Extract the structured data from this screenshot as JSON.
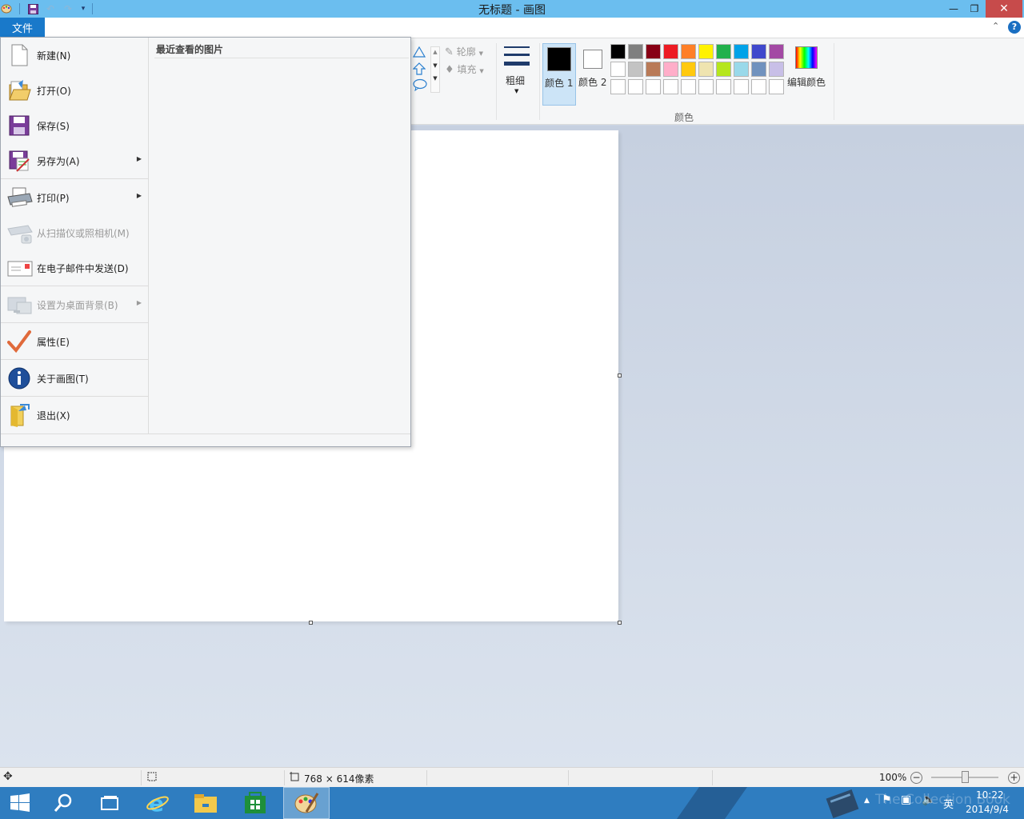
{
  "window": {
    "title": "无标题 - 画图",
    "minimize_icon": "minimize-icon",
    "maximize_icon": "restore-icon",
    "close_icon": "close-icon"
  },
  "quick_access": {
    "items": [
      "app-icon",
      "save-icon",
      "undo-icon",
      "redo-icon",
      "customize-icon"
    ]
  },
  "ribbon": {
    "file_tab": "文件",
    "shapes": {
      "outline_label": "轮廓",
      "fill_label": "填充"
    },
    "size_label": "粗细",
    "colors": {
      "color1_label": "颜色 1",
      "color2_label": "颜色 2",
      "edit_colors_label": "编辑颜色",
      "group_label": "颜色",
      "color1_value": "#000000",
      "color2_value": "#ffffff",
      "palette_row1": [
        "#000000",
        "#7f7f7f",
        "#880015",
        "#ed1c24",
        "#ff7f27",
        "#fff200",
        "#22b14c",
        "#00a2e8",
        "#3f48cc",
        "#a349a4"
      ],
      "palette_row2": [
        "#ffffff",
        "#c3c3c3",
        "#b97a57",
        "#ffaec9",
        "#ffc90e",
        "#efe4b0",
        "#b5e61d",
        "#99d9ea",
        "#7092be",
        "#c8bfe7"
      ],
      "palette_row3": [
        "#ffffff",
        "#ffffff",
        "#ffffff",
        "#ffffff",
        "#ffffff",
        "#ffffff",
        "#ffffff",
        "#ffffff",
        "#ffffff",
        "#ffffff"
      ]
    }
  },
  "file_menu": {
    "items": [
      {
        "label": "新建(N)",
        "icon": "new-file-icon",
        "has_submenu": false,
        "disabled": false
      },
      {
        "label": "打开(O)",
        "icon": "open-folder-icon",
        "has_submenu": false,
        "disabled": false
      },
      {
        "label": "保存(S)",
        "icon": "save-disk-icon",
        "has_submenu": false,
        "disabled": false
      },
      {
        "label": "另存为(A)",
        "icon": "save-as-icon",
        "has_submenu": true,
        "disabled": false
      },
      {
        "label": "打印(P)",
        "icon": "printer-icon",
        "has_submenu": true,
        "disabled": false
      },
      {
        "label": "从扫描仪或照相机(M)",
        "icon": "scanner-icon",
        "has_submenu": false,
        "disabled": true
      },
      {
        "label": "在电子邮件中发送(D)",
        "icon": "email-icon",
        "has_submenu": false,
        "disabled": false
      },
      {
        "label": "设置为桌面背景(B)",
        "icon": "desktop-background-icon",
        "has_submenu": true,
        "disabled": true
      },
      {
        "label": "属性(E)",
        "icon": "checkmark-icon",
        "has_submenu": false,
        "disabled": false
      },
      {
        "label": "关于画图(T)",
        "icon": "info-icon",
        "has_submenu": false,
        "disabled": false
      },
      {
        "label": "退出(X)",
        "icon": "exit-icon",
        "has_submenu": false,
        "disabled": false
      }
    ],
    "recent_title": "最近查看的图片"
  },
  "statusbar": {
    "image_size": "768 × 614像素",
    "zoom": "100%",
    "zoom_level": 1.0
  },
  "taskbar": {
    "items": [
      "start-icon",
      "search-icon",
      "task-view-icon",
      "internet-explorer-icon",
      "file-explorer-icon",
      "store-icon",
      "paint-icon"
    ],
    "tray": {
      "ime": "英",
      "time": "10:22",
      "date": "2014/9/4"
    }
  },
  "watermark": "The Collection Book"
}
